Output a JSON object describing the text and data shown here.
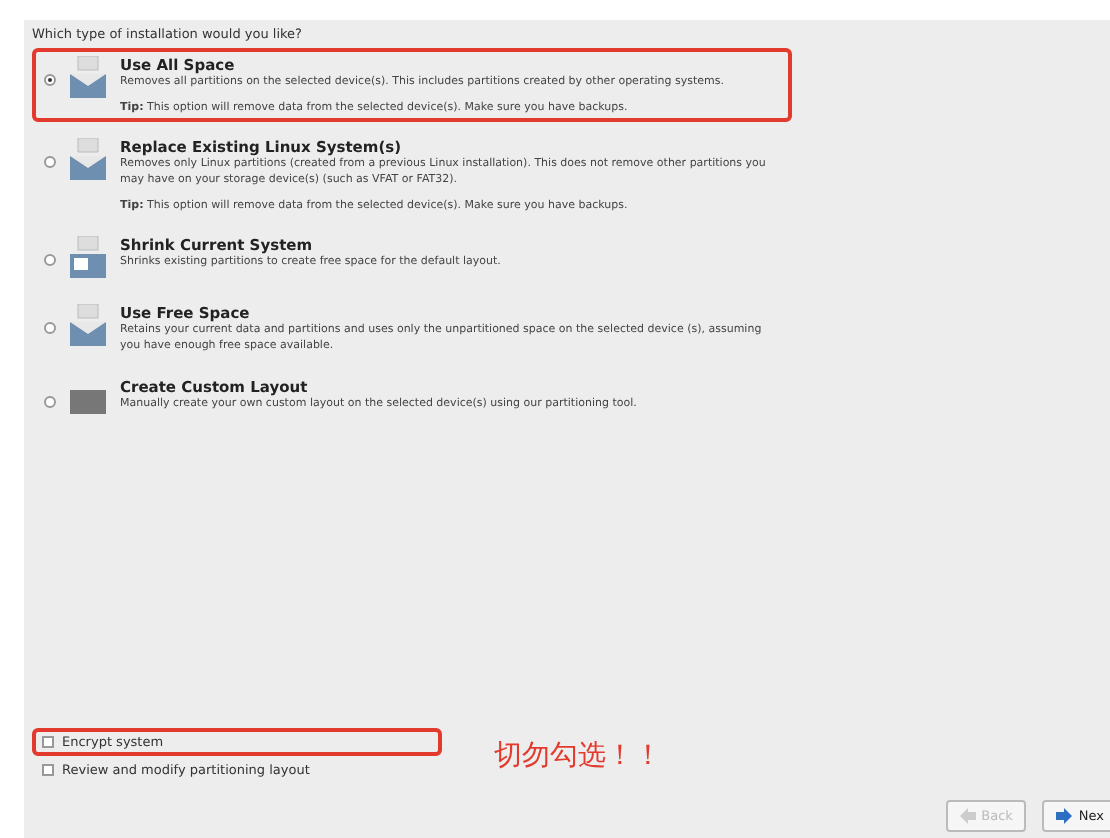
{
  "question": "Which type of installation would you like?",
  "options": [
    {
      "title": "Use All Space",
      "description": "Removes all partitions on the selected device(s).  This includes partitions created by other operating systems.",
      "tip": "**Tip:** This option will remove data from the selected device(s).  Make sure you have backups.",
      "selected": true,
      "highlighted": true,
      "kind": "disk"
    },
    {
      "title": "Replace Existing Linux System(s)",
      "description": "Removes only Linux partitions (created from a previous Linux installation).  This does not remove other partitions you may have on your storage device(s) (such as VFAT or FAT32).",
      "tip": "**Tip:** This option will remove data from the selected device(s).  Make sure you have backups.",
      "selected": false,
      "highlighted": false,
      "kind": "disk"
    },
    {
      "title": "Shrink Current System",
      "description": "Shrinks existing partitions to create free space for the default layout.",
      "selected": false,
      "highlighted": false,
      "kind": "shrink"
    },
    {
      "title": "Use Free Space",
      "description": "Retains your current data and partitions and uses only the unpartitioned space on the selected device (s), assuming you have enough free space available.",
      "selected": false,
      "highlighted": false,
      "kind": "disk"
    },
    {
      "title": "Create Custom Layout",
      "description": "Manually create your own custom layout on the selected device(s) using our partitioning tool.",
      "selected": false,
      "highlighted": false,
      "kind": "custom"
    }
  ],
  "checkboxes": [
    {
      "label": "Encrypt system",
      "checked": false,
      "highlighted": true
    },
    {
      "label": "Review and modify partitioning layout",
      "checked": false,
      "highlighted": false
    }
  ],
  "annotation": "切勿勾选！！",
  "buttons": [
    {
      "label": "Back",
      "disabled": true
    },
    {
      "label": "Nex",
      "disabled": false
    }
  ]
}
